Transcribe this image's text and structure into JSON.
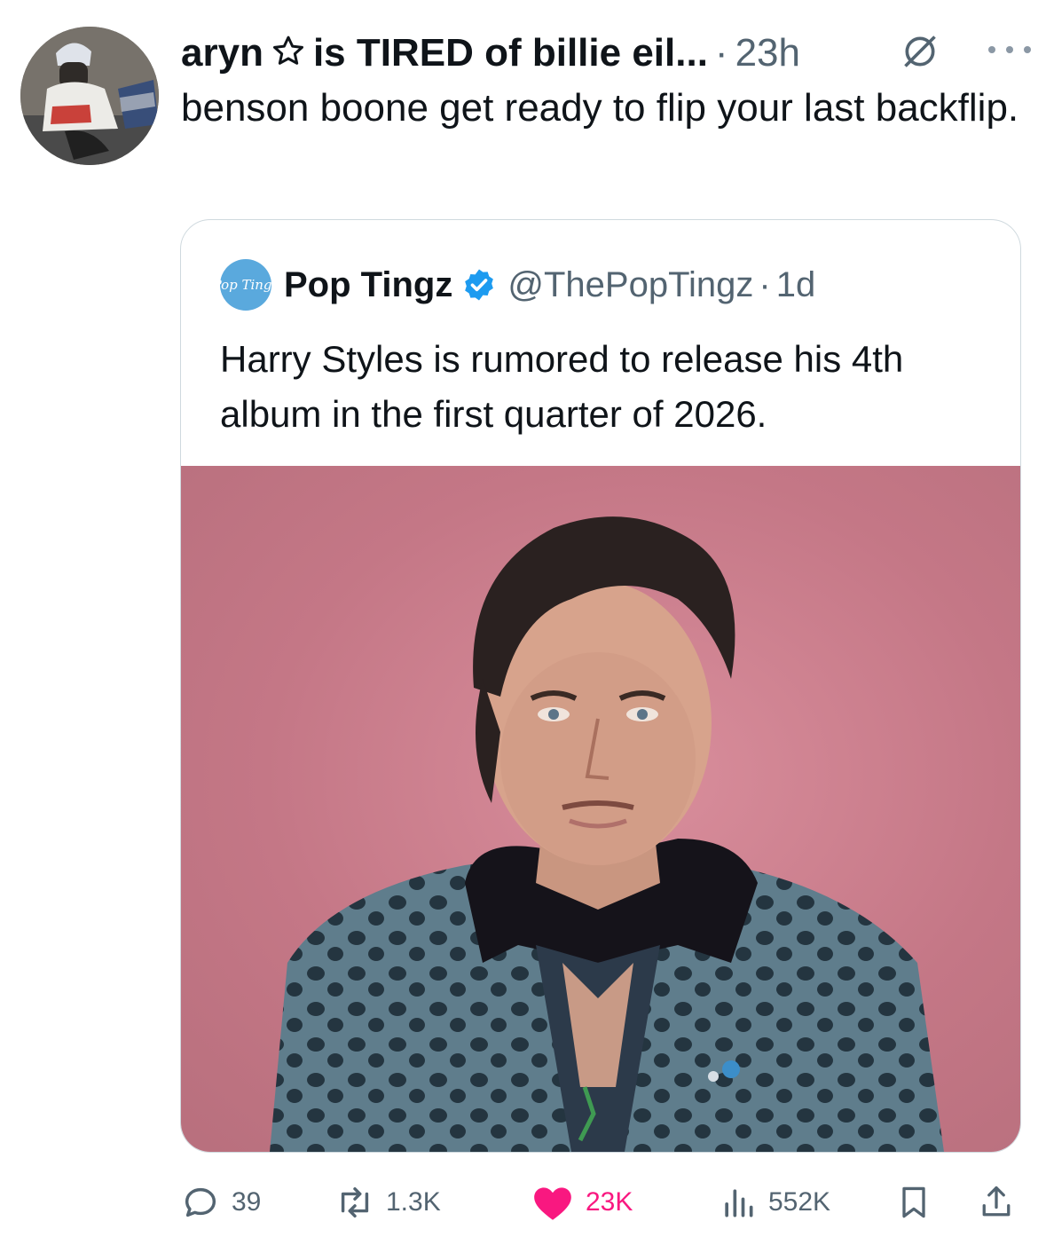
{
  "post": {
    "display_name": "aryn",
    "name_suffix": "is TIRED of billie eil...",
    "separator": "·",
    "time": "23h",
    "text": "benson boone get ready to flip your last backflip."
  },
  "quote": {
    "name": "Pop Tingz",
    "handle": "@ThePopTingz",
    "separator": "·",
    "time": "1d",
    "text": "Harry Styles is rumored to release his 4th album in the first quarter of 2026.",
    "avatar_text": "Pop Tingz"
  },
  "actions": {
    "replies": "39",
    "reposts": "1.3K",
    "likes": "23K",
    "views": "552K"
  },
  "colors": {
    "text": "#0f1419",
    "secondary": "#536471",
    "like": "#f91880",
    "verified": "#1d9bf0",
    "border": "#cfd9de"
  },
  "icons": [
    "star-icon",
    "grok-icon",
    "more-icon",
    "verified-icon",
    "reply-icon",
    "repost-icon",
    "heart-icon",
    "views-icon",
    "bookmark-icon",
    "share-icon"
  ]
}
